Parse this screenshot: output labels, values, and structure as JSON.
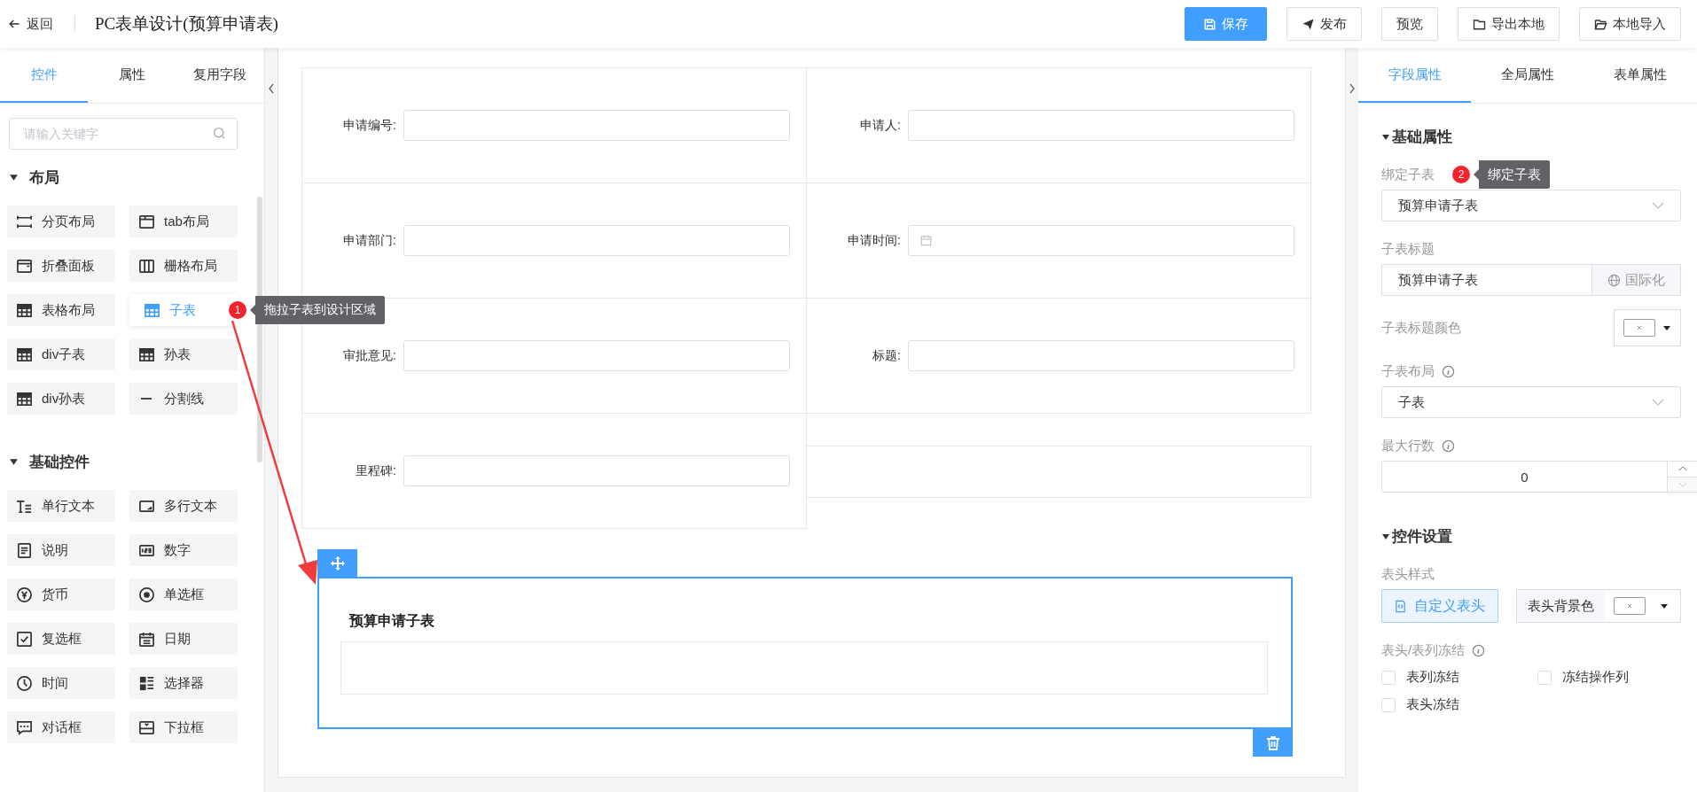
{
  "topbar": {
    "back": "返回",
    "title": "PC表单设计(预算申请表)",
    "buttons": [
      {
        "label": "保存",
        "kind": "save",
        "primary": true
      },
      {
        "label": "发布",
        "kind": "send",
        "primary": false
      },
      {
        "label": "预览",
        "kind": "plain",
        "primary": false
      },
      {
        "label": "导出本地",
        "kind": "export",
        "primary": false
      },
      {
        "label": "本地导入",
        "kind": "import",
        "primary": false
      }
    ]
  },
  "left_panel": {
    "tabs": [
      {
        "label": "控件",
        "selected": true
      },
      {
        "label": "属性",
        "selected": false
      },
      {
        "label": "复用字段",
        "selected": false
      }
    ],
    "search": {
      "placeholder": "请输入关键字"
    },
    "groups": [
      {
        "title": "布局",
        "expanded": true,
        "items": [
          {
            "label": "分页布局",
            "kind": "pager",
            "selected": false
          },
          {
            "label": "tab布局",
            "kind": "tab",
            "selected": false
          },
          {
            "label": "折叠面板",
            "kind": "collapse",
            "selected": false
          },
          {
            "label": "栅格布局",
            "kind": "columns",
            "selected": false
          },
          {
            "label": "表格布局",
            "kind": "table",
            "selected": false
          },
          {
            "label": "子表",
            "kind": "table",
            "selected": true,
            "badge": "1",
            "tooltip": "拖拉子表到设计区域"
          },
          {
            "label": "div子表",
            "kind": "table",
            "selected": false
          },
          {
            "label": "孙表",
            "kind": "table",
            "selected": false
          },
          {
            "label": "div孙表",
            "kind": "table",
            "selected": false
          },
          {
            "label": "分割线",
            "kind": "divider",
            "selected": false
          }
        ]
      },
      {
        "title": "基础控件",
        "expanded": true,
        "items": [
          {
            "label": "单行文本",
            "kind": "text",
            "selected": false
          },
          {
            "label": "多行文本",
            "kind": "textarea",
            "selected": false
          },
          {
            "label": "说明",
            "kind": "note",
            "selected": false
          },
          {
            "label": "数字",
            "kind": "number",
            "selected": false
          },
          {
            "label": "货币",
            "kind": "currency",
            "selected": false
          },
          {
            "label": "单选框",
            "kind": "radio",
            "selected": false
          },
          {
            "label": "复选框",
            "kind": "checkbox",
            "selected": false
          },
          {
            "label": "日期",
            "kind": "date",
            "selected": false
          },
          {
            "label": "时间",
            "kind": "time",
            "selected": false
          },
          {
            "label": "选择器",
            "kind": "selector",
            "selected": false
          },
          {
            "label": "对话框",
            "kind": "dialog",
            "selected": false
          },
          {
            "label": "下拉框",
            "kind": "dropdown",
            "selected": false
          }
        ]
      }
    ]
  },
  "canvas": {
    "fields": [
      {
        "label": "申请编号:",
        "kind": "text"
      },
      {
        "label": "申请人:",
        "kind": "text"
      },
      {
        "label": "申请部门:",
        "kind": "text"
      },
      {
        "label": "申请时间:",
        "kind": "date"
      },
      {
        "label": "审批意见:",
        "kind": "text"
      },
      {
        "label": "标题:",
        "kind": "text"
      },
      {
        "label": "里程碑:",
        "kind": "text"
      }
    ],
    "subtable": {
      "title": "预算申请子表",
      "selected": true
    }
  },
  "right_panel": {
    "tabs": [
      {
        "label": "字段属性",
        "selected": true
      },
      {
        "label": "全局属性",
        "selected": false
      },
      {
        "label": "表单属性",
        "selected": false
      }
    ],
    "sections": [
      {
        "title": "基础属性",
        "expanded": true,
        "props": [
          {
            "kind": "select",
            "label": "绑定子表",
            "info": false,
            "value": "预算申请子表",
            "badge": "2",
            "tooltip": "绑定子表"
          },
          {
            "kind": "i18n-input",
            "label": "子表标题",
            "info": false,
            "value": "预算申请子表",
            "button": "国际化"
          },
          {
            "kind": "color",
            "label": "子表标题颜色",
            "info": false
          },
          {
            "kind": "select",
            "label": "子表布局",
            "info": true,
            "value": "子表"
          },
          {
            "kind": "number",
            "label": "最大行数",
            "info": true,
            "value": "0"
          }
        ]
      },
      {
        "title": "控件设置",
        "expanded": true,
        "props": [
          {
            "kind": "header-style",
            "label": "表头样式",
            "info": false,
            "button": "自定义表头",
            "selected": true,
            "color_label": "表头背景色"
          },
          {
            "kind": "checkboxes",
            "label": "表头/表列冻结",
            "info": true,
            "options": [
              {
                "label": "表列冻结",
                "checked": false
              },
              {
                "label": "冻结操作列",
                "checked": false
              },
              {
                "label": "表头冻结",
                "checked": false
              }
            ]
          }
        ]
      }
    ]
  }
}
